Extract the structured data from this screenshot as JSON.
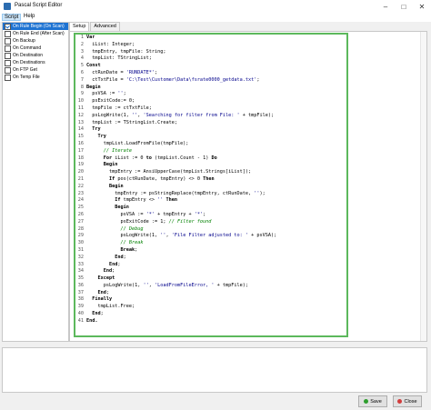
{
  "window": {
    "title": "Pascal Script Editor"
  },
  "menu": {
    "items": [
      "Script",
      "Help"
    ]
  },
  "events": [
    {
      "label": "On Rule Begin (On Scan)",
      "checked": true,
      "selected": true
    },
    {
      "label": "On Rule End (After Scan)",
      "checked": false,
      "selected": false
    },
    {
      "label": "On Backup",
      "checked": false,
      "selected": false
    },
    {
      "label": "On Command",
      "checked": false,
      "selected": false
    },
    {
      "label": "On Destination",
      "checked": false,
      "selected": false
    },
    {
      "label": "On Destinations",
      "checked": false,
      "selected": false
    },
    {
      "label": "On FTP Get",
      "checked": false,
      "selected": false
    },
    {
      "label": "On Temp File",
      "checked": false,
      "selected": false
    }
  ],
  "tabs": [
    "Setup",
    "Advanced"
  ],
  "code_lines": [
    [
      {
        "t": "Var",
        "c": "kw"
      }
    ],
    [
      {
        "t": "  iList: Integer;",
        "c": ""
      }
    ],
    [
      {
        "t": "  tmpEntry, tmpFile: String;",
        "c": ""
      }
    ],
    [
      {
        "t": "  tmpList: TStringList;",
        "c": ""
      }
    ],
    [
      {
        "t": "Const",
        "c": "kw"
      }
    ],
    [
      {
        "t": "  ctRunDate = ",
        "c": ""
      },
      {
        "t": "'RUNDATE*'",
        "c": "str"
      },
      {
        "t": ";",
        "c": ""
      }
    ],
    [
      {
        "t": "  ctTxtFile = ",
        "c": ""
      },
      {
        "t": "'C:\\Test\\Customer\\Data\\fsrate0000_getdata.txt'",
        "c": "str"
      },
      {
        "t": ";",
        "c": ""
      }
    ],
    [
      {
        "t": "Begin",
        "c": "kw"
      }
    ],
    [
      {
        "t": "  psVSA := ",
        "c": ""
      },
      {
        "t": "''",
        "c": "str"
      },
      {
        "t": ";",
        "c": ""
      }
    ],
    [
      {
        "t": "  psExitCode:= 0;",
        "c": ""
      }
    ],
    [
      {
        "t": "  tmpFile := ctTxtFile;",
        "c": ""
      }
    ],
    [
      {
        "t": "  psLogWrite(1, ",
        "c": ""
      },
      {
        "t": "''",
        "c": "str"
      },
      {
        "t": ", ",
        "c": ""
      },
      {
        "t": "'Searching for filter from File: '",
        "c": "str"
      },
      {
        "t": " + tmpFile);",
        "c": ""
      }
    ],
    [
      {
        "t": "  tmpList := TStringList.Create;",
        "c": ""
      }
    ],
    [
      {
        "t": "  ",
        "c": ""
      },
      {
        "t": "Try",
        "c": "kw"
      }
    ],
    [
      {
        "t": "    ",
        "c": ""
      },
      {
        "t": "Try",
        "c": "kw"
      }
    ],
    [
      {
        "t": "      tmpList.LoadFromFile(tmpFile);",
        "c": ""
      }
    ],
    [
      {
        "t": "      ",
        "c": ""
      },
      {
        "t": "// Iterate",
        "c": "cm"
      }
    ],
    [
      {
        "t": "      ",
        "c": ""
      },
      {
        "t": "For",
        "c": "kw"
      },
      {
        "t": " iList := 0 ",
        "c": ""
      },
      {
        "t": "to",
        "c": "kw"
      },
      {
        "t": " (tmpList.Count - 1) ",
        "c": ""
      },
      {
        "t": "Do",
        "c": "kw"
      }
    ],
    [
      {
        "t": "      ",
        "c": ""
      },
      {
        "t": "Begin",
        "c": "kw"
      }
    ],
    [
      {
        "t": "        tmpEntry := AnsiUpperCase(tmpList.Strings[iList]);",
        "c": ""
      }
    ],
    [
      {
        "t": "        ",
        "c": ""
      },
      {
        "t": "If",
        "c": "kw"
      },
      {
        "t": " pos(ctRunDate, tmpEntry) <> 0 ",
        "c": ""
      },
      {
        "t": "Then",
        "c": "kw"
      }
    ],
    [
      {
        "t": "        ",
        "c": ""
      },
      {
        "t": "Begin",
        "c": "kw"
      }
    ],
    [
      {
        "t": "          tmpEntry := psStringReplace(tmpEntry, ctRunDate, ",
        "c": ""
      },
      {
        "t": "''",
        "c": "str"
      },
      {
        "t": ");",
        "c": ""
      }
    ],
    [
      {
        "t": "          ",
        "c": ""
      },
      {
        "t": "If",
        "c": "kw"
      },
      {
        "t": " tmpEntry <> ",
        "c": ""
      },
      {
        "t": "''",
        "c": "str"
      },
      {
        "t": " ",
        "c": ""
      },
      {
        "t": "Then",
        "c": "kw"
      }
    ],
    [
      {
        "t": "          ",
        "c": ""
      },
      {
        "t": "Begin",
        "c": "kw"
      }
    ],
    [
      {
        "t": "            psVSA := ",
        "c": ""
      },
      {
        "t": "'*'",
        "c": "str"
      },
      {
        "t": " + tmpEntry + ",
        "c": ""
      },
      {
        "t": "'*'",
        "c": "str"
      },
      {
        "t": ";",
        "c": ""
      }
    ],
    [
      {
        "t": "            psExitCode := 1; ",
        "c": ""
      },
      {
        "t": "// Filter found",
        "c": "cm"
      }
    ],
    [
      {
        "t": "            ",
        "c": ""
      },
      {
        "t": "// Debug",
        "c": "cm"
      }
    ],
    [
      {
        "t": "            psLogWrite(1, ",
        "c": ""
      },
      {
        "t": "''",
        "c": "str"
      },
      {
        "t": ", ",
        "c": ""
      },
      {
        "t": "'File Filter adjusted to: '",
        "c": "str"
      },
      {
        "t": " + psVSA);",
        "c": ""
      }
    ],
    [
      {
        "t": "            ",
        "c": ""
      },
      {
        "t": "// Break",
        "c": "cm"
      }
    ],
    [
      {
        "t": "            ",
        "c": ""
      },
      {
        "t": "Break",
        "c": "kw"
      },
      {
        "t": ";",
        "c": ""
      }
    ],
    [
      {
        "t": "          ",
        "c": ""
      },
      {
        "t": "End",
        "c": "kw"
      },
      {
        "t": ";",
        "c": ""
      }
    ],
    [
      {
        "t": "        ",
        "c": ""
      },
      {
        "t": "End",
        "c": "kw"
      },
      {
        "t": ";",
        "c": ""
      }
    ],
    [
      {
        "t": "      ",
        "c": ""
      },
      {
        "t": "End",
        "c": "kw"
      },
      {
        "t": ";",
        "c": ""
      }
    ],
    [
      {
        "t": "    ",
        "c": ""
      },
      {
        "t": "Except",
        "c": "kw"
      }
    ],
    [
      {
        "t": "      psLogWrite(1, ",
        "c": ""
      },
      {
        "t": "''",
        "c": "str"
      },
      {
        "t": ", ",
        "c": ""
      },
      {
        "t": "'LoadFromFileError, '",
        "c": "str"
      },
      {
        "t": " + tmpFile);",
        "c": ""
      }
    ],
    [
      {
        "t": "    ",
        "c": ""
      },
      {
        "t": "End",
        "c": "kw"
      },
      {
        "t": ";",
        "c": ""
      }
    ],
    [
      {
        "t": "  ",
        "c": ""
      },
      {
        "t": "Finally",
        "c": "kw"
      }
    ],
    [
      {
        "t": "    tmpList.Free;",
        "c": ""
      }
    ],
    [
      {
        "t": "  ",
        "c": ""
      },
      {
        "t": "End",
        "c": "kw"
      },
      {
        "t": ";",
        "c": ""
      }
    ],
    [
      {
        "t": "End.",
        "c": "kw"
      }
    ]
  ],
  "buttons": {
    "save": "Save",
    "close": "Close"
  },
  "colors": {
    "highlight_border": "#5cb85c",
    "selection": "#1e73d2"
  }
}
